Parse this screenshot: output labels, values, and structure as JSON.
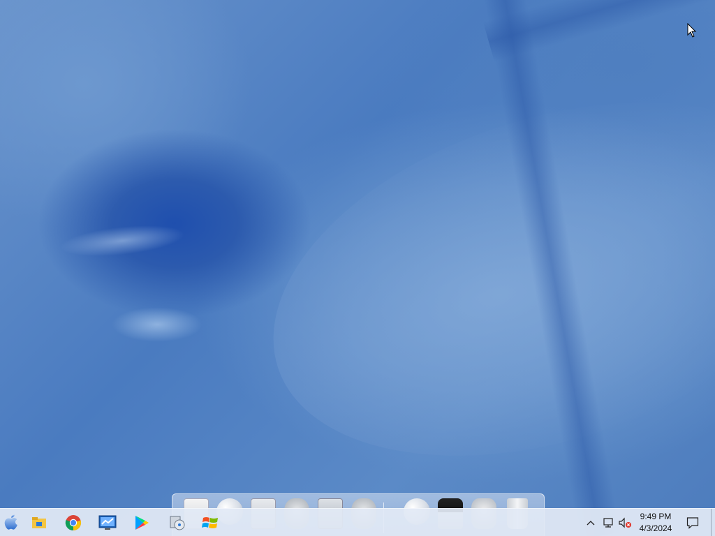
{
  "desktop": {
    "wallpaper": "abstract-blue-sweep",
    "accent": "#4a7bc0"
  },
  "dock": {
    "items": [
      {
        "name": "document-icon"
      },
      {
        "name": "globe-icon"
      },
      {
        "name": "panel-icon"
      },
      {
        "name": "tools-icon"
      },
      {
        "name": "picture-icon"
      },
      {
        "name": "network-icon"
      },
      {
        "name": "internet-icon"
      },
      {
        "name": "mac-icon"
      },
      {
        "name": "hammer-icon"
      },
      {
        "name": "trash-icon"
      }
    ]
  },
  "taskbar": {
    "apps": [
      {
        "name": "apple-start-icon"
      },
      {
        "name": "file-explorer-icon"
      },
      {
        "name": "chrome-icon"
      },
      {
        "name": "remote-desktop-icon"
      },
      {
        "name": "play-store-icon"
      },
      {
        "name": "installer-icon"
      },
      {
        "name": "windows-icon"
      }
    ],
    "tray": {
      "time": "9:49 PM",
      "date": "4/3/2024"
    }
  }
}
